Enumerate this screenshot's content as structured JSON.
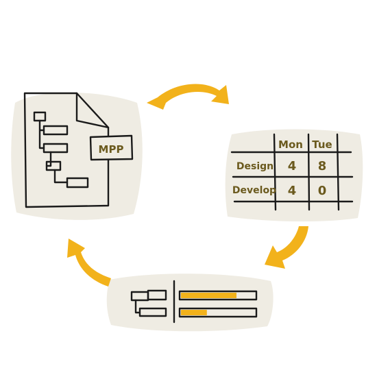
{
  "file": {
    "badge": "MPP"
  },
  "table": {
    "columns": [
      "Mon",
      "Tue"
    ],
    "rows": [
      {
        "label": "Design",
        "values": [
          "4",
          "8"
        ]
      },
      {
        "label": "Develop",
        "values": [
          "4",
          "0"
        ]
      }
    ]
  },
  "gantt": {
    "bars": [
      {
        "progress": 0.75
      },
      {
        "progress": 0.35
      }
    ]
  },
  "colors": {
    "arrow": "#f2b21b",
    "ink": "#1a1a1a",
    "label": "#6b5a1e",
    "wash": "#efece3"
  },
  "icons": [
    "project-file-icon",
    "timesheet-table-icon",
    "gantt-chart-icon",
    "cycle-arrow-icon"
  ]
}
